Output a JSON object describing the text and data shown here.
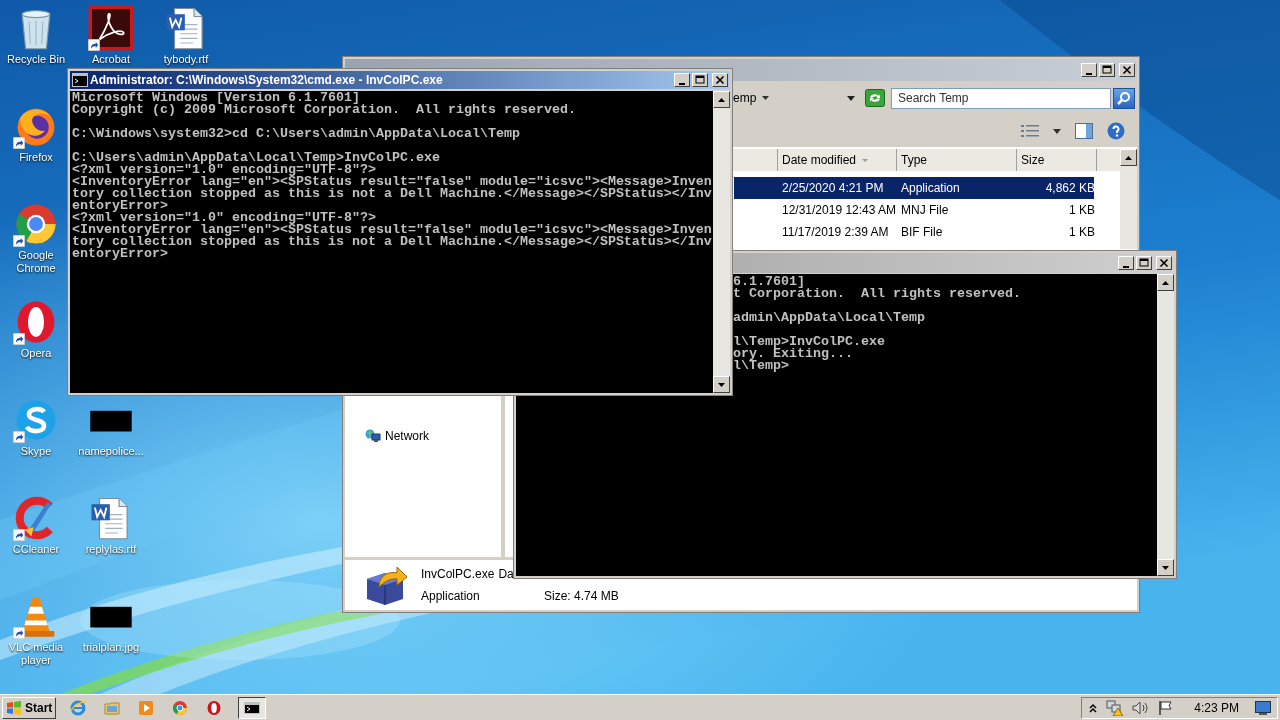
{
  "desktop_icons": [
    {
      "label": "Recycle Bin",
      "kind": "recycle",
      "shortcut": false
    },
    {
      "label": "Acrobat",
      "kind": "acrobat",
      "shortcut": true
    },
    {
      "label": "tybody.rtf",
      "kind": "word",
      "shortcut": false
    },
    {
      "label": "Firefox",
      "kind": "firefox",
      "shortcut": true
    },
    {
      "label": "Google Chrome",
      "kind": "chrome",
      "shortcut": true
    },
    {
      "label": "Opera",
      "kind": "opera",
      "shortcut": true
    },
    {
      "label": "Skype",
      "kind": "skype",
      "shortcut": true
    },
    {
      "label": "namepolice...",
      "kind": "blank",
      "shortcut": false
    },
    {
      "label": "CCleaner",
      "kind": "ccleaner",
      "shortcut": true
    },
    {
      "label": "replylas.rtf",
      "kind": "word",
      "shortcut": false
    },
    {
      "label": "VLC media player",
      "kind": "vlc",
      "shortcut": true
    },
    {
      "label": "trialplan.jpg",
      "kind": "blank",
      "shortcut": false
    }
  ],
  "explorer": {
    "address": "emp",
    "search": {
      "placeholder": "Search Temp"
    },
    "columns": [
      "Date modified",
      "Type",
      "Size"
    ],
    "rows": [
      {
        "date": "2/25/2020 4:21 PM",
        "type": "Application",
        "size": "4,862 KB",
        "selected": true
      },
      {
        "date": "12/31/2019 12:43 AM",
        "type": "MNJ File",
        "size": "1 KB",
        "selected": false
      },
      {
        "date": "11/17/2019 2:39 AM",
        "type": "BIF File",
        "size": "1 KB",
        "selected": false
      }
    ],
    "nav_items": [
      "Network"
    ],
    "details": {
      "name": "InvColPC.exe",
      "cut_label": "Da",
      "type": "Application",
      "size": "Size: 4.74 MB"
    }
  },
  "console_back": {
    "blocks": [
      [
        "6.1.7601]",
        "t Corporation.  All rights reserved."
      ],
      [
        "admin\\AppData\\Local\\Temp"
      ],
      [
        "l\\Temp>InvColPC.exe",
        "ory. Exiting...",
        "l\\Temp>"
      ]
    ]
  },
  "console_front": {
    "title": "Administrator: C:\\Windows\\System32\\cmd.exe - InvColPC.exe",
    "blocks": [
      [
        "Microsoft Windows [Version 6.1.7601]",
        "Copyright (c) 2009 Microsoft Corporation.  All rights reserved."
      ],
      [
        "C:\\Windows\\system32>cd C:\\Users\\admin\\AppData\\Local\\Temp"
      ],
      [
        "C:\\Users\\admin\\AppData\\Local\\Temp>InvColPC.exe",
        "<?xml version=\"1.0\" encoding=\"UTF-8\"?>",
        "<InventoryError lang=\"en\"><SPStatus result=\"false\" module=\"icsvc\"><Message>Inven",
        "tory collection stopped as this is not a Dell Machine.</Message></SPStatus></Inv",
        "entoryError>",
        "<?xml version=\"1.0\" encoding=\"UTF-8\"?>",
        "<InventoryError lang=\"en\"><SPStatus result=\"false\" module=\"icsvc\"><Message>Inven",
        "tory collection stopped as this is not a Dell Machine.</Message></SPStatus></Inv",
        "entoryError>"
      ]
    ]
  },
  "taskbar": {
    "start": "Start",
    "apps": [
      {
        "kind": "ie",
        "pressed": false
      },
      {
        "kind": "folder",
        "pressed": false
      },
      {
        "kind": "media",
        "pressed": false
      },
      {
        "kind": "chrome",
        "pressed": false
      },
      {
        "kind": "opera",
        "pressed": false
      },
      {
        "kind": "cmd",
        "pressed": true
      }
    ],
    "clock": "4:23 PM"
  }
}
